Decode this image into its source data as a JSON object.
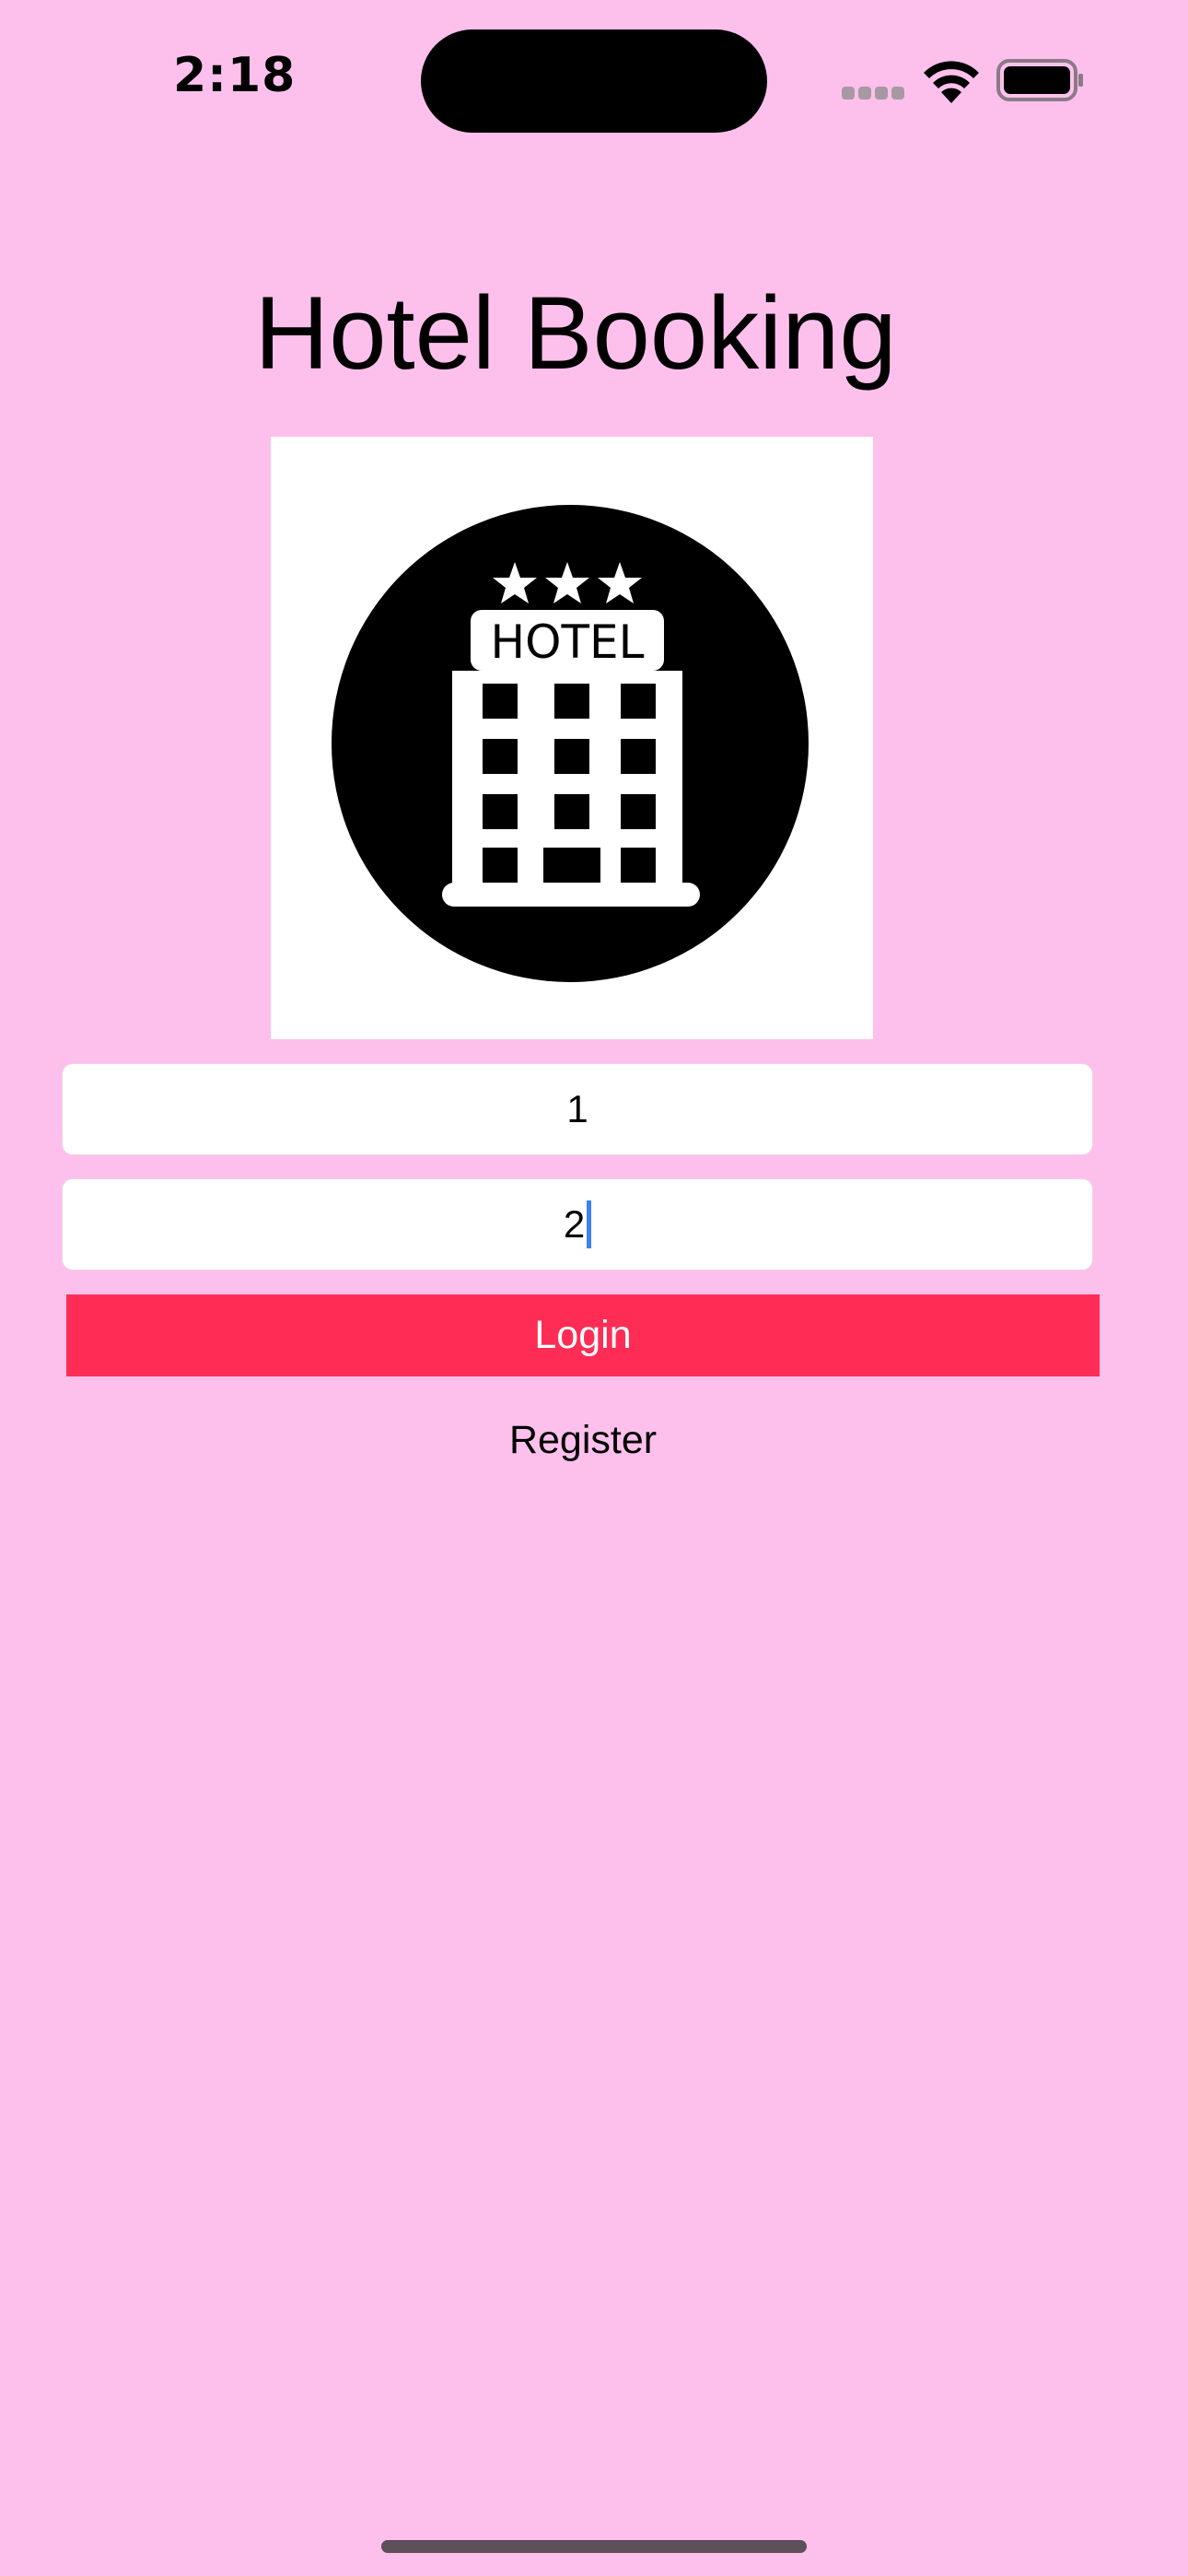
{
  "status_bar": {
    "time": "2:18",
    "icons": [
      "cellular-signal-icon",
      "wifi-icon",
      "battery-icon"
    ]
  },
  "header": {
    "title": "Hotel Booking"
  },
  "logo": {
    "icon": "hotel-building-icon",
    "text": "HOTEL",
    "stars": 3
  },
  "form": {
    "username_value": "1",
    "password_value": "2",
    "login_label": "Login",
    "register_label": "Register"
  },
  "colors": {
    "background": "#fdc0ec",
    "login_button": "#ff2d55",
    "caret": "#3b82f6"
  }
}
